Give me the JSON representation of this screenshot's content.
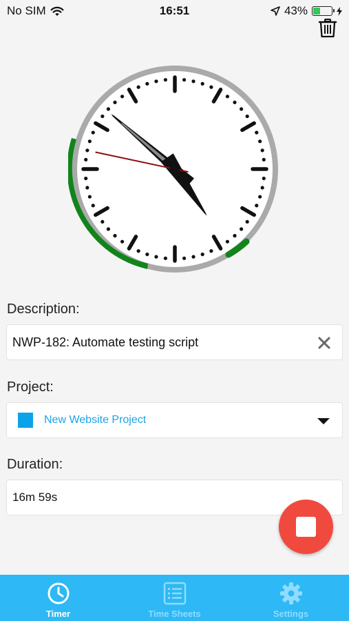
{
  "status_bar": {
    "carrier": "No SIM",
    "time": "16:51",
    "battery_percent": "43%",
    "battery_level": 0.43,
    "icons": [
      "wifi-icon",
      "location-arrow-icon",
      "battery-icon",
      "charging-bolt-icon"
    ]
  },
  "header": {
    "delete_icon": "trash-icon"
  },
  "clock": {
    "time_shown": "16:51",
    "seconds_shown": 47,
    "elapsed_arc_color": "#11841a",
    "ring_color": "#aaaaaa",
    "second_hand_color": "#8b1010"
  },
  "description": {
    "label": "Description:",
    "value": "NWP-182: Automate testing script",
    "clear_icon": "close-icon"
  },
  "project": {
    "label": "Project:",
    "value": "New Website Project",
    "color": "#0aa3e8",
    "dropdown_icon": "chevron-down-icon"
  },
  "duration": {
    "label": "Duration:",
    "value": "16m 59s"
  },
  "stop_button": {
    "icon": "stop-icon",
    "color": "#f04a3e"
  },
  "tabs": [
    {
      "label": "Timer",
      "icon": "clock-icon",
      "active": true
    },
    {
      "label": "Time Sheets",
      "icon": "list-icon",
      "active": false
    },
    {
      "label": "Settings",
      "icon": "gear-icon",
      "active": false
    }
  ],
  "colors": {
    "tab_bar": "#2eb8f5",
    "accent": "#1aa3e8"
  }
}
